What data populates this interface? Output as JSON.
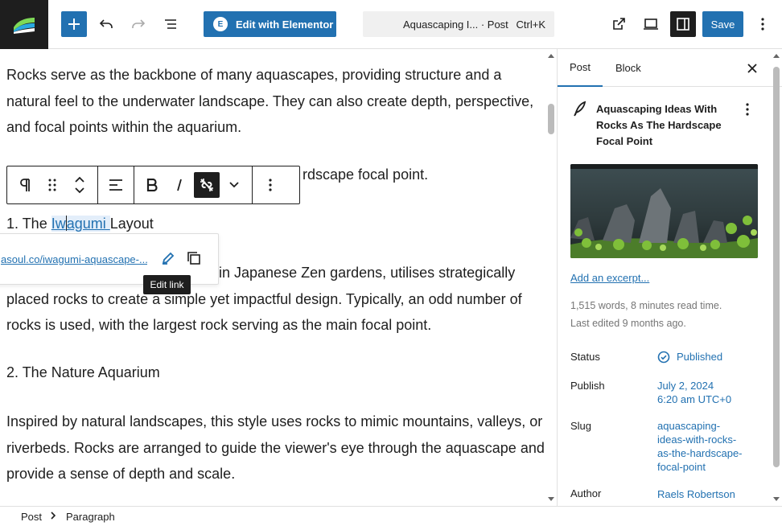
{
  "toolbar": {
    "edit_elementor_label": "Edit with Elementor",
    "elementor_logo_text": "E",
    "command_title": "Aquascaping I... · Post",
    "command_shortcut": "Ctrl+K",
    "save_label": "Save"
  },
  "content": {
    "p1_lines": [
      "Rocks serve as the backbone of many aquascapes, providing structure and a",
      "natural feel to the underwater landscape. They can also create depth, perspective,",
      "and focal points within the aquarium."
    ],
    "p2_visible": "rdscape focal point.",
    "p3_before": "1. The ",
    "p3_link_part1": "Iw",
    "p3_link_part2": "agumi ",
    "p3_after": "Layout",
    "p4_lines": [
      "in Japanese Zen gardens, utilises strategically",
      "placed rocks to create a simple yet impactful design. Typically, an odd number of",
      "rocks is used, with the largest rock serving as the main focal point."
    ],
    "p5": "2. The Nature Aquarium",
    "p6_lines": [
      "Inspired by natural landscapes, this style uses rocks to mimic mountains, valleys, or",
      "riverbeds. Rocks are arranged to guide the viewer's eye through the aquascape and",
      "provide a sense of depth and scale."
    ]
  },
  "link_popover": {
    "url": "asoul.co/iwagumi-aquascape-...",
    "tooltip": "Edit link"
  },
  "sidebar": {
    "tab_post": "Post",
    "tab_block": "Block",
    "post_title": "Aquascaping Ideas With Rocks As The Hardscape Focal Point",
    "excerpt_link": "Add an excerpt...",
    "meta_words": "1,515 words, 8 minutes read time.",
    "meta_edited": "Last edited 9 months ago.",
    "status_label": "Status",
    "status_value": "Published",
    "publish_label": "Publish",
    "publish_date": "July 2, 2024",
    "publish_time": "6:20 am UTC+0",
    "slug_label": "Slug",
    "slug_lines": [
      "aquascaping-",
      "ideas-with-rocks-",
      "as-the-hardscape-",
      "focal-point"
    ],
    "author_label": "Author",
    "author_value": "Raels Robertson"
  },
  "footer": {
    "crumb_post": "Post",
    "crumb_paragraph": "Paragraph"
  },
  "colors": {
    "accent": "#2271b1",
    "dark": "#1e1e1e"
  }
}
